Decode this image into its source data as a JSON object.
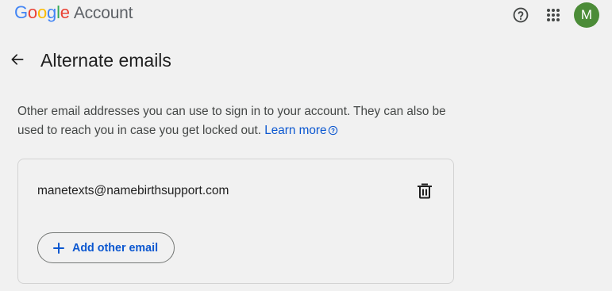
{
  "header": {
    "logo_letters": [
      {
        "char": "G",
        "color": "#4285F4"
      },
      {
        "char": "o",
        "color": "#EA4335"
      },
      {
        "char": "o",
        "color": "#FBBC05"
      },
      {
        "char": "g",
        "color": "#4285F4"
      },
      {
        "char": "l",
        "color": "#34A853"
      },
      {
        "char": "e",
        "color": "#EA4335"
      }
    ],
    "product_name": "Account",
    "help_icon": "help-circle-icon",
    "apps_icon": "apps-grid-icon",
    "avatar_initial": "M",
    "avatar_color": "#4C8C38"
  },
  "page": {
    "title": "Alternate emails",
    "back_icon": "arrow-left-icon",
    "description": "Other email addresses you can use to sign in to your account. They can also be used to reach you in case you get locked out.",
    "learn_more_label": "Learn more",
    "learn_more_icon": "help-circle-icon"
  },
  "card": {
    "email": "manetexts@namebirthsupport.com",
    "delete_icon": "trash-icon",
    "add_icon": "plus-icon",
    "add_label": "Add other email"
  },
  "colors": {
    "background": "#F1F1F1",
    "link": "#0B57D0",
    "text_primary": "#1F1F1F",
    "text_secondary": "#444746",
    "border": "#D3D3D3"
  }
}
